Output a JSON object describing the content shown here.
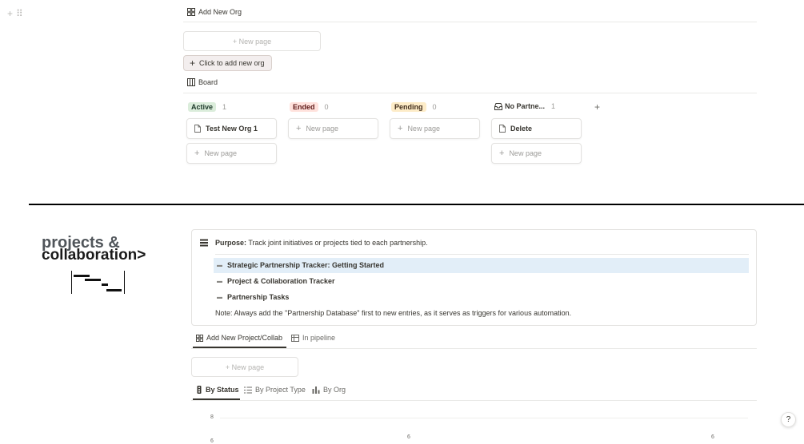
{
  "top_view": {
    "title": "Add New Org",
    "new_page_label": "+ New page",
    "click_add_org_label": "Click to add new org"
  },
  "board": {
    "title": "Board",
    "columns": [
      {
        "name": "Active",
        "count": "1",
        "cards": [
          {
            "title": "Test New Org 1"
          }
        ],
        "new_page": "New page"
      },
      {
        "name": "Ended",
        "count": "0",
        "cards": [],
        "new_page": "New page"
      },
      {
        "name": "Pending",
        "count": "0",
        "cards": [],
        "new_page": "New page"
      },
      {
        "name": "No Partne...",
        "count": "1",
        "cards": [
          {
            "title": "Delete"
          }
        ],
        "new_page": "New page"
      }
    ],
    "add_group_label": "+"
  },
  "heading": {
    "line1": "projects &",
    "line2": "collaboration>"
  },
  "callout": {
    "purpose_label": "Purpose:",
    "purpose_text": "Track joint initiatives or projects tied to each partnership.",
    "links": [
      "Strategic Partnership Tracker: Getting Started",
      "Project & Collaboration Tracker",
      "Partnership Tasks"
    ],
    "note": "Note: Always add the \"Partnership Database\" first to new entries, as it serves as triggers for various automation."
  },
  "project_tabs": [
    {
      "label": "Add New Project/Collab",
      "icon": "gallery-icon",
      "active": true
    },
    {
      "label": "In pipeline",
      "icon": "table-icon",
      "active": false
    }
  ],
  "project_new_page": "+ New page",
  "chart_tabs": [
    {
      "label": "By Status",
      "icon": "traffic-light-icon",
      "active": true
    },
    {
      "label": "By Project Type",
      "icon": "list-icon",
      "active": false
    },
    {
      "label": "By Org",
      "icon": "bar-chart-icon",
      "active": false
    }
  ],
  "chart_partial": {
    "y_ticks": [
      "8",
      "6"
    ],
    "data_labels": [
      "6",
      "6"
    ]
  },
  "help_label": "?"
}
